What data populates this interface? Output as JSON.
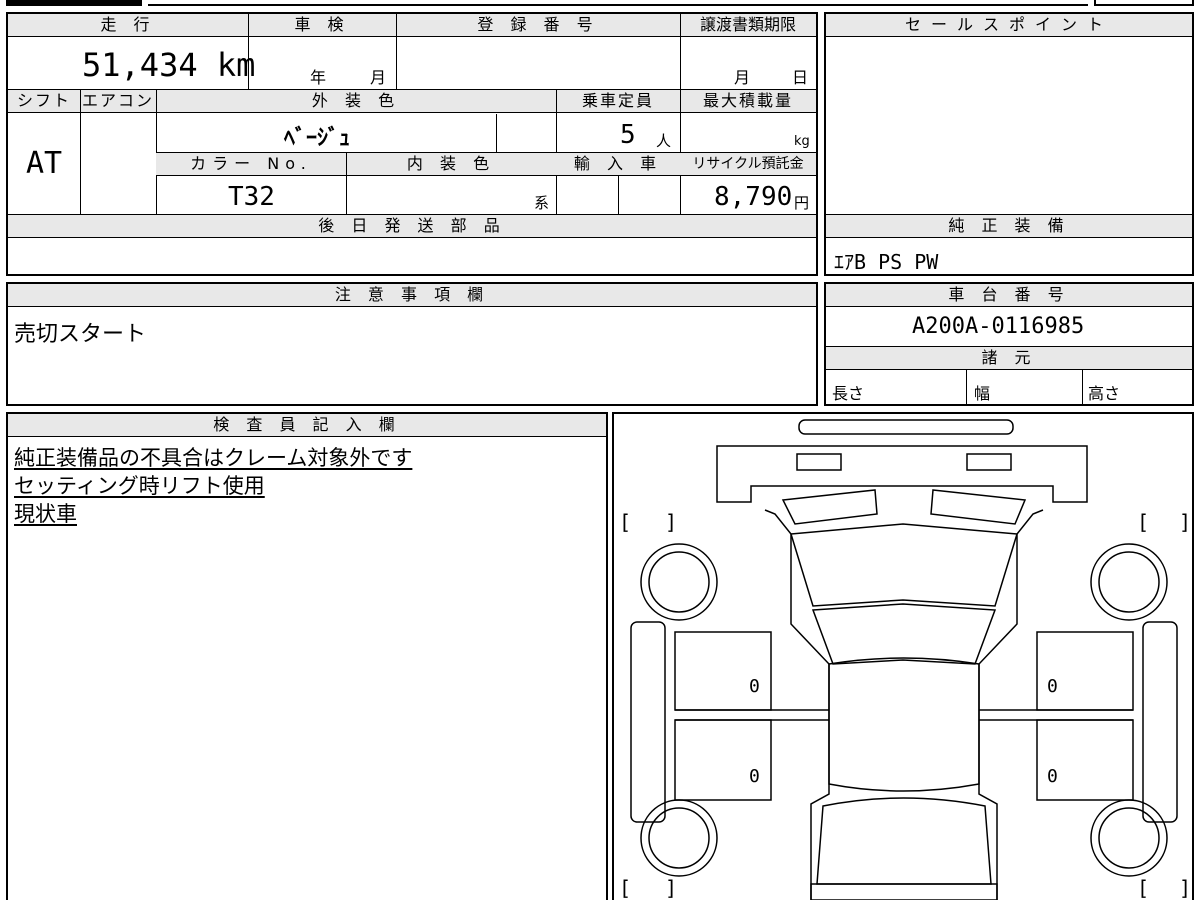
{
  "vehicle": {
    "mileage_label": "走 行",
    "mileage_value": "51,434 km",
    "inspection_label": "車 検",
    "inspection_year_unit": "年",
    "inspection_month_unit": "月",
    "registration_label": "登 録 番 号",
    "transfer_deadline_label": "譲渡書類期限",
    "transfer_month_unit": "月",
    "transfer_day_unit": "日",
    "shift_label": "シフト",
    "shift_value": "AT",
    "aircon_label": "エアコン",
    "exterior_color_label": "外 装 色",
    "exterior_color_value": "ﾍﾞｰｼﾞｭ",
    "capacity_label": "乗車定員",
    "capacity_value": "5",
    "capacity_unit": "人",
    "max_load_label": "最大積載量",
    "max_load_unit": "kg",
    "color_no_label": "カラー No.",
    "color_no_value": "T32",
    "interior_color_label": "内 装 色",
    "interior_color_suffix": "系",
    "import_label": "輸 入 車",
    "recycle_label": "リサイクル預託金",
    "recycle_value": "8,790",
    "recycle_unit": "円",
    "parts_later_label": "後 日 発 送 部 品"
  },
  "sales_points": {
    "label": "セールスポイント"
  },
  "genuine_equipment": {
    "label": "純 正 装 備",
    "value": "ｴｱB PS PW"
  },
  "notes": {
    "label": "注 意 事 項 欄",
    "value": "売切スタート"
  },
  "chassis": {
    "label": "車 台 番 号",
    "value": "A200A-0116985"
  },
  "specs": {
    "label": "諸 元",
    "length_label": "長さ",
    "width_label": "幅",
    "height_label": "高さ"
  },
  "inspector": {
    "label": "検 査 員 記 入 欄",
    "lines": [
      "純正装備品の不具合はクレーム対象外です",
      "セッティング時リフト使用",
      "現状車"
    ]
  },
  "diagram": {
    "marks": [
      "0",
      "0",
      "0",
      "0"
    ],
    "bracket_open": "[",
    "bracket_close": "]"
  }
}
